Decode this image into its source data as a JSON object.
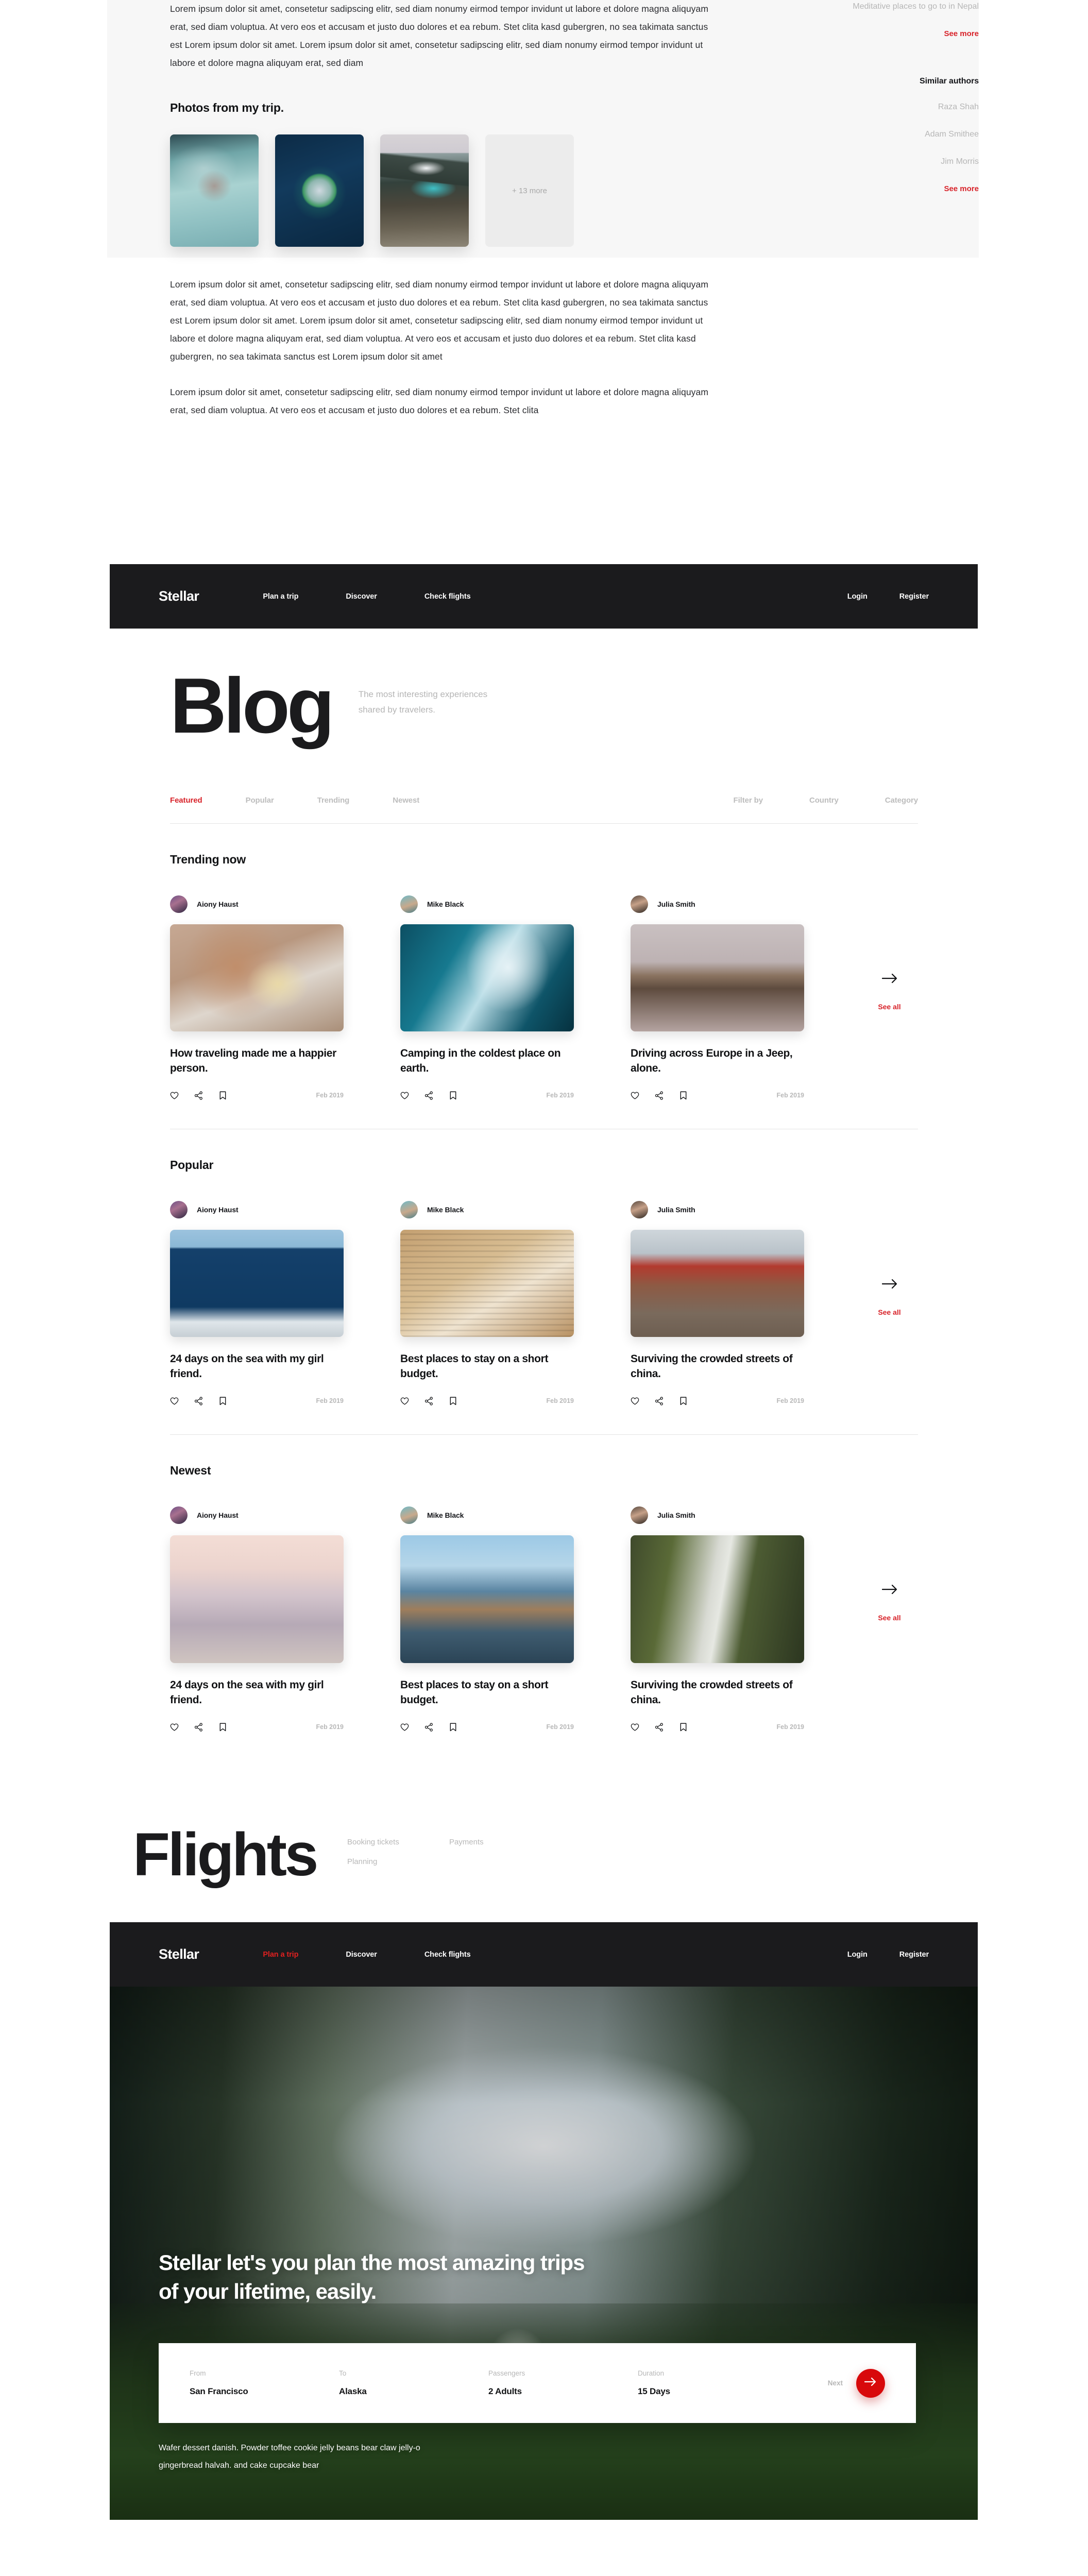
{
  "colors": {
    "accent": "#d8232a",
    "accent_btn": "#d8090b",
    "dark": "#1b1b1d",
    "muted": "#b6b6b6"
  },
  "article": {
    "body_paragraph_1": "Lorem ipsum dolor sit amet, consetetur sadipscing elitr, sed diam nonumy eirmod tempor invidunt ut labore et dolore magna aliquyam erat, sed diam voluptua. At vero eos et accusam et justo duo dolores et ea rebum. Stet clita kasd gubergren, no sea takimata sanctus est Lorem ipsum dolor sit amet. Lorem ipsum dolor sit amet, consetetur sadipscing elitr, sed diam nonumy eirmod tempor invidunt ut labore et dolore magna aliquyam erat, sed diam",
    "photos_title": "Photos from my trip.",
    "more_photos_label": "+ 13 more",
    "body_paragraph_2": "Lorem ipsum dolor sit amet, consetetur sadipscing elitr, sed diam nonumy eirmod tempor invidunt ut labore et dolore magna aliquyam erat, sed diam voluptua. At vero eos et accusam et justo duo dolores et ea rebum. Stet clita kasd gubergren, no sea takimata sanctus est Lorem ipsum dolor sit amet. Lorem ipsum dolor sit amet, consetetur sadipscing elitr, sed diam nonumy eirmod tempor invidunt ut labore et dolore magna aliquyam erat, sed diam voluptua. At vero eos et accusam et justo duo dolores et ea rebum. Stet clita kasd gubergren, no sea takimata sanctus est Lorem ipsum dolor sit amet",
    "body_paragraph_3": "Lorem ipsum dolor sit amet, consetetur sadipscing elitr, sed diam nonumy eirmod tempor invidunt ut labore et dolore magna aliquyam erat, sed diam voluptua. At vero eos et accusam et justo duo dolores et ea rebum. Stet clita",
    "photos": [
      {
        "alt": "woman floating in pool"
      },
      {
        "alt": "aerial island in ocean"
      },
      {
        "alt": "turquoise mountain lake"
      }
    ],
    "sidebar": {
      "related_title": "Meditative places to go to in Nepal",
      "related_see_more": "See more",
      "authors_title": "Similar authors",
      "authors": [
        "Raza Shah",
        "Adam Smithee",
        "Jim Morris"
      ],
      "authors_see_more": "See more"
    }
  },
  "nav": {
    "brand": "Stellar",
    "links": [
      "Plan a trip",
      "Discover",
      "Check flights"
    ],
    "login": "Login",
    "register": "Register"
  },
  "blog": {
    "title": "Blog",
    "subtitle_line_1": "The most interesting experiences",
    "subtitle_line_2": "shared by travelers.",
    "tabs": [
      "Featured",
      "Popular",
      "Trending",
      "Newest"
    ],
    "active_tab": "Featured",
    "filters": [
      "Filter by",
      "Country",
      "Category"
    ],
    "see_all_label": "See all",
    "sections": [
      {
        "heading": "Trending now",
        "cards": [
          {
            "author": "Aiony Haust",
            "title": "How traveling made me a happier person.",
            "date": "Feb 2019",
            "shape": "land",
            "art": "img-sunbathe",
            "avatar": "av-a"
          },
          {
            "author": "Mike Black",
            "title": "Camping in the coldest place on earth.",
            "date": "Feb 2019",
            "shape": "land",
            "art": "img-ice",
            "avatar": "av-b"
          },
          {
            "author": "Julia Smith",
            "title": "Driving across Europe in a Jeep, alone.",
            "date": "Feb 2019",
            "shape": "land",
            "art": "img-jeep",
            "avatar": "av-c"
          }
        ]
      },
      {
        "heading": "Popular",
        "cards": [
          {
            "author": "Aiony Haust",
            "title": "24 days on the sea with my girl friend.",
            "date": "Feb 2019",
            "shape": "land",
            "art": "img-boat",
            "avatar": "av-a"
          },
          {
            "author": "Mike Black",
            "title": "Best places to stay on a short budget.",
            "date": "Feb 2019",
            "shape": "land",
            "art": "img-wall",
            "avatar": "av-b"
          },
          {
            "author": "Julia Smith",
            "title": "Surviving the crowded streets of china.",
            "date": "Feb 2019",
            "shape": "land",
            "art": "img-crowd",
            "avatar": "av-c"
          }
        ]
      },
      {
        "heading": "Newest",
        "cards": [
          {
            "author": "Aiony Haust",
            "title": "24 days on the sea with my girl friend.",
            "date": "Feb 2019",
            "shape": "port",
            "art": "img-pink",
            "avatar": "av-a"
          },
          {
            "author": "Mike Black",
            "title": "Best places to stay on a short budget.",
            "date": "Feb 2019",
            "shape": "port",
            "art": "img-cliff",
            "avatar": "av-b"
          },
          {
            "author": "Julia Smith",
            "title": "Surviving the crowded streets of china.",
            "date": "Feb 2019",
            "shape": "port",
            "art": "img-falls",
            "avatar": "av-c"
          }
        ]
      }
    ]
  },
  "flights": {
    "title": "Flights",
    "links_col_1": [
      "Booking tickets",
      "Planning"
    ],
    "links_col_2": [
      "Payments"
    ]
  },
  "hero": {
    "nav_active": "Plan a trip",
    "headline_line_1": "Stellar let's you plan the most amazing trips",
    "headline_line_2": "of your lifetime, easily.",
    "booking": {
      "fields": [
        {
          "label": "From",
          "value": "San Francisco"
        },
        {
          "label": "To",
          "value": "Alaska"
        },
        {
          "label": "Passengers",
          "value": "2 Adults"
        },
        {
          "label": "Duration",
          "value": "15 Days"
        }
      ],
      "next_label": "Next"
    },
    "caption_line_1": "Wafer dessert danish. Powder toffee cookie jelly beans bear claw jelly-o",
    "caption_line_2": "gingerbread halvah. and cake cupcake bear"
  }
}
